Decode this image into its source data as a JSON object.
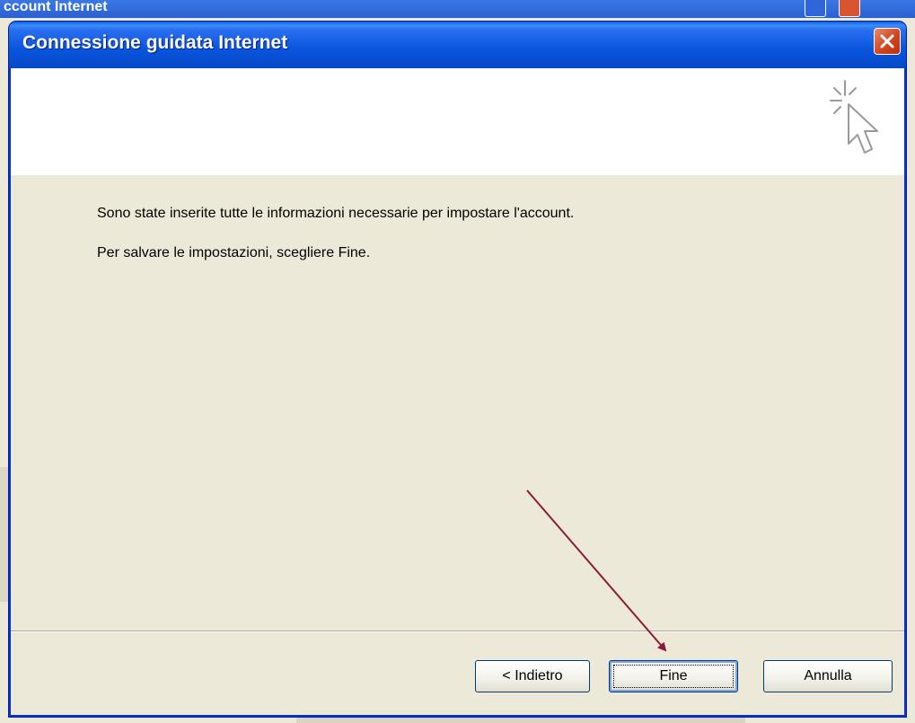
{
  "background_window": {
    "title": "ccount Internet"
  },
  "wizard": {
    "title": "Connessione guidata Internet",
    "message_1": "Sono state inserite tutte le informazioni necessarie per impostare l'account.",
    "message_2": "Per salvare le impostazioni, scegliere Fine.",
    "buttons": {
      "back": "< Indietro",
      "finish": "Fine",
      "cancel": "Annulla"
    },
    "icons": {
      "close": "close-icon",
      "header": "wizard-cursor-icon"
    },
    "annotation": {
      "arrow_color": "#8b1a3a",
      "points_to": "finish-button"
    }
  },
  "colors": {
    "titlebar": "#0855dd",
    "dialog_bg": "#ece9d8",
    "close_button": "#d2451e"
  }
}
